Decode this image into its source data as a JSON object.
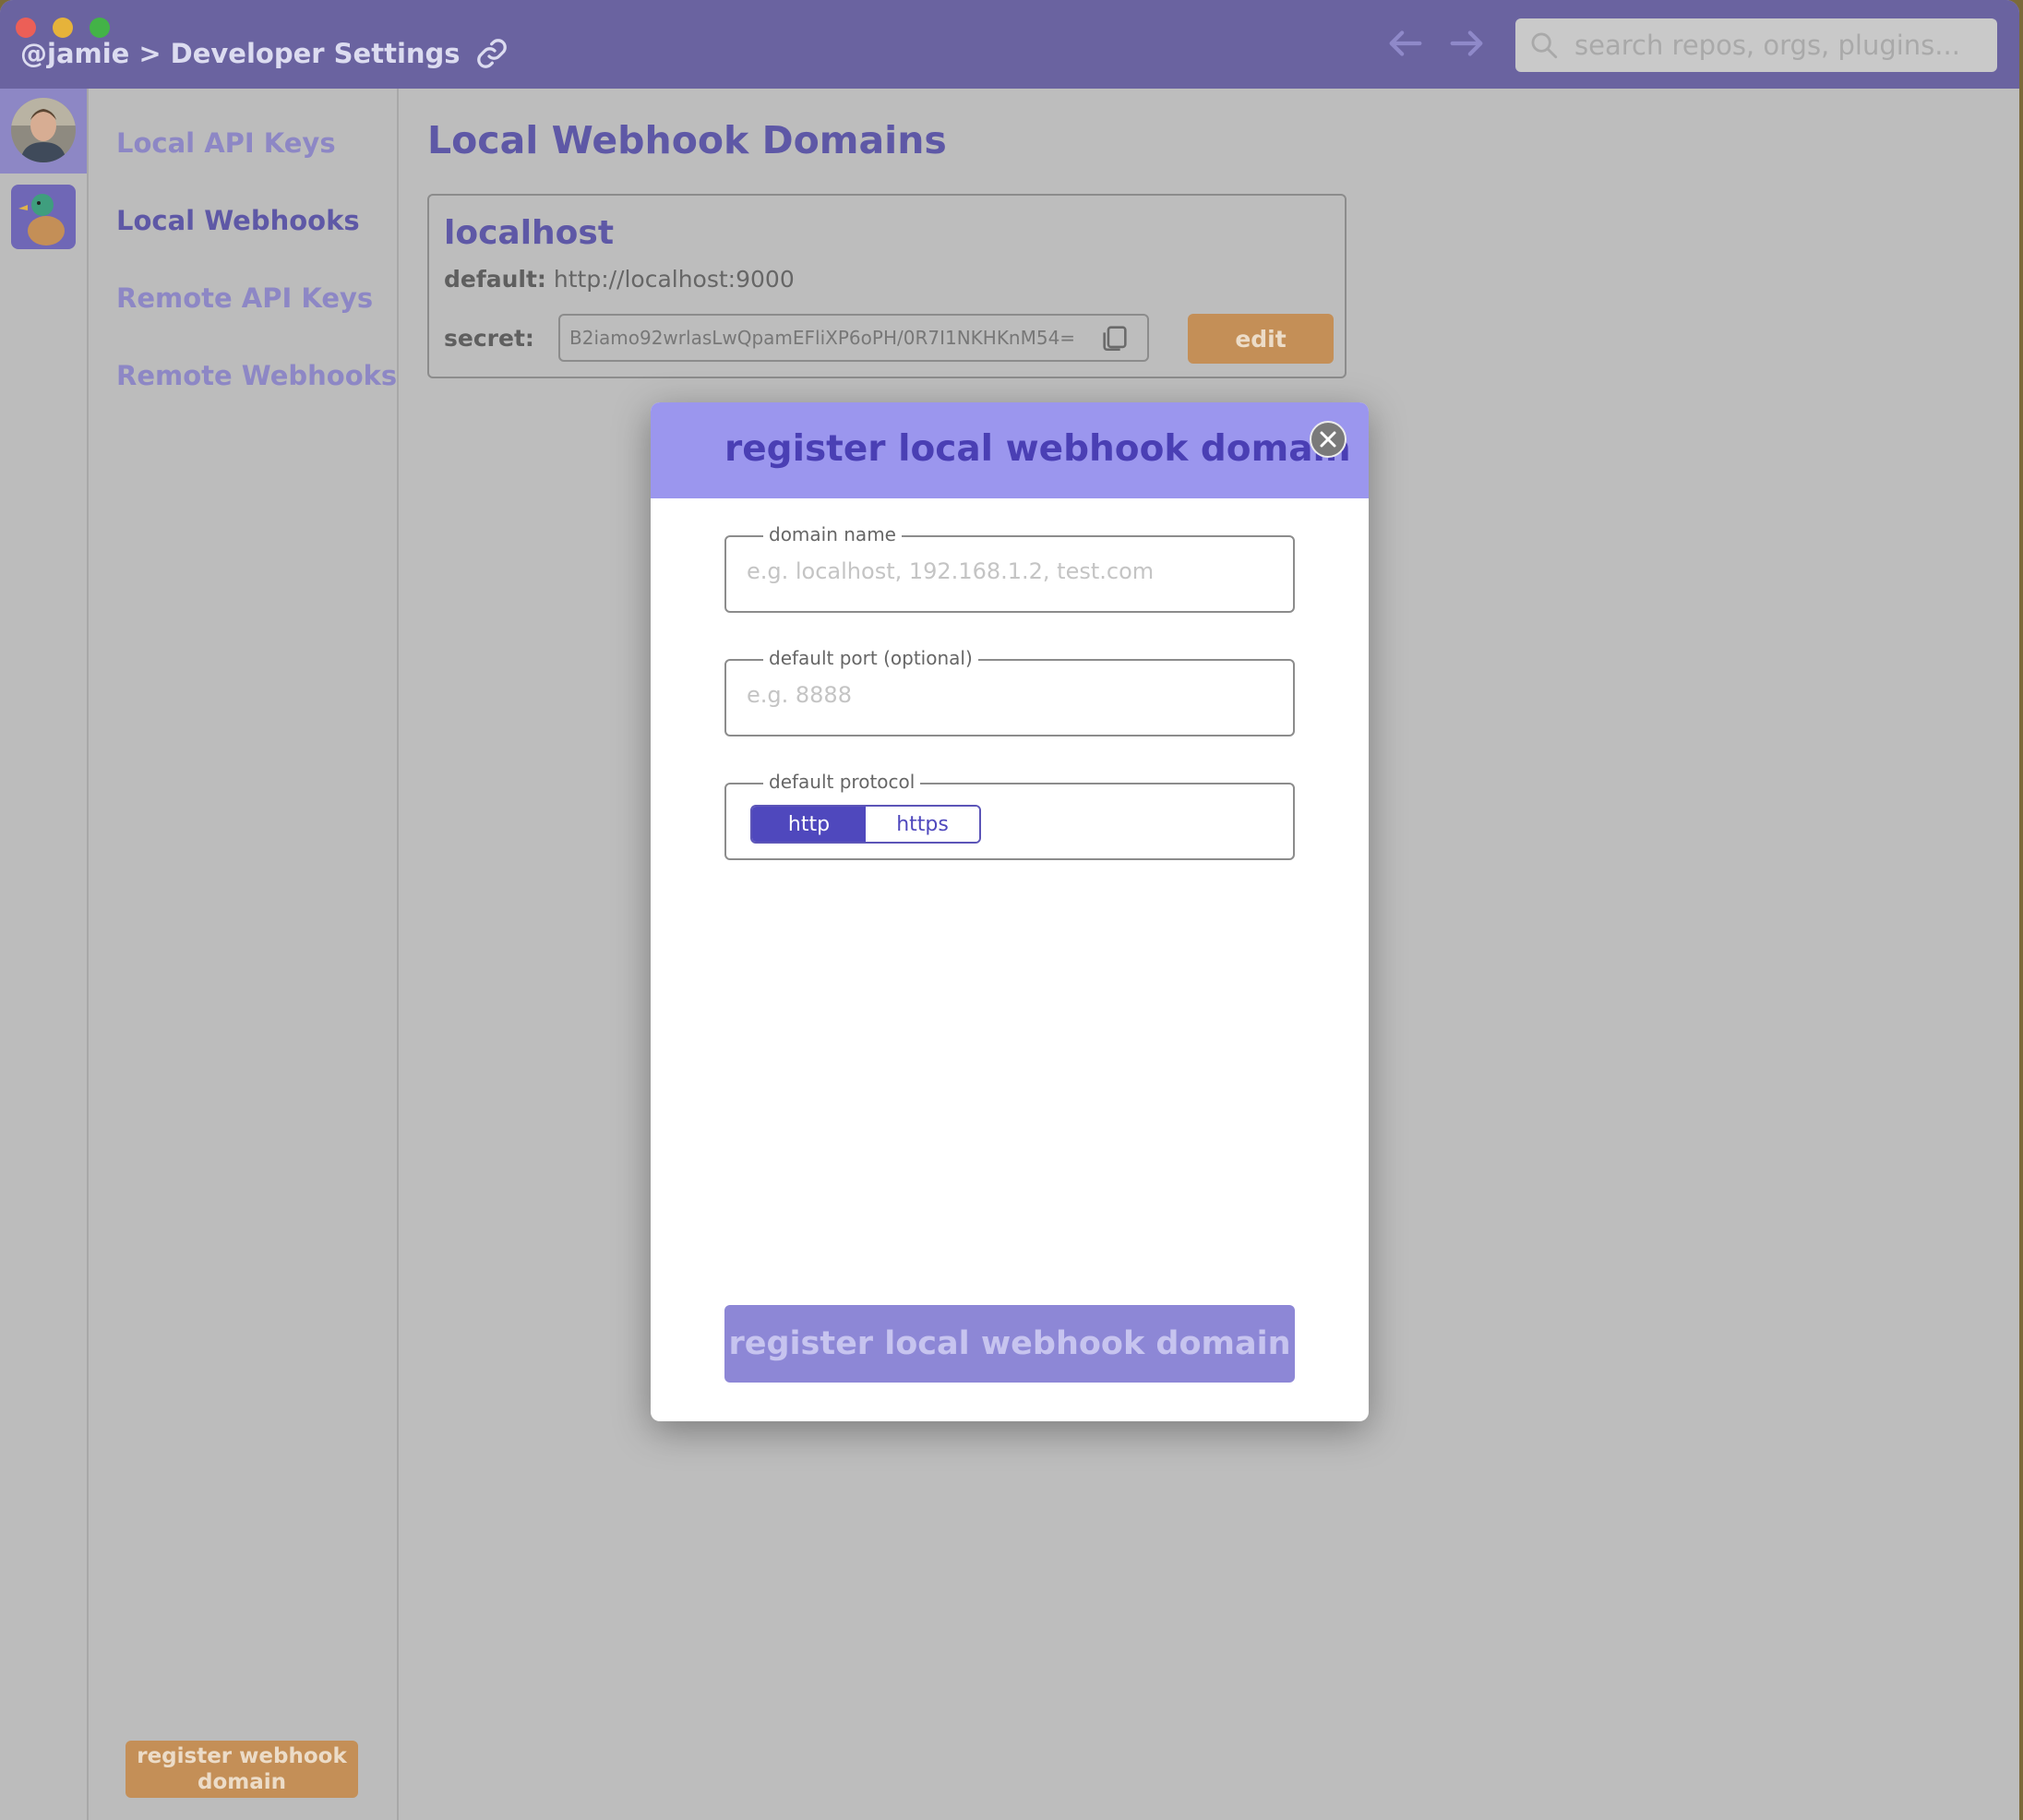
{
  "window": {
    "breadcrumb": {
      "user": "@jamie",
      "separator": ">",
      "page": "Developer Settings"
    },
    "search": {
      "placeholder": "search repos, orgs, plugins..."
    }
  },
  "sidebar": {
    "items": [
      {
        "label": "Local API Keys",
        "active": false
      },
      {
        "label": "Local Webhooks",
        "active": true
      },
      {
        "label": "Remote API Keys",
        "active": false
      },
      {
        "label": "Remote Webhooks",
        "active": false
      }
    ],
    "register_button": "register webhook domain"
  },
  "main": {
    "title": "Local Webhook Domains",
    "domains": [
      {
        "name": "localhost",
        "default_label": "default:",
        "default_value": "http://localhost:9000",
        "secret_label": "secret:",
        "secret_value": "B2iamo92wrlasLwQpamEFliXP6oPH/0R7I1NKHKnM54=",
        "edit_label": "edit"
      }
    ]
  },
  "modal": {
    "title": "register local webhook domain",
    "domain_name": {
      "legend": "domain name",
      "placeholder": "e.g. localhost, 192.168.1.2, test.com",
      "value": ""
    },
    "default_port": {
      "legend": "default port (optional)",
      "placeholder": "e.g. 8888",
      "value": ""
    },
    "default_protocol": {
      "legend": "default protocol",
      "options": [
        "http",
        "https"
      ],
      "selected": "http"
    },
    "submit_label": "register local webhook domain"
  },
  "colors": {
    "titlebar": "#6a63a0",
    "accent": "#5e58a6",
    "modal_header": "#9b96ee",
    "orange_button": "#c48f57"
  },
  "icons": [
    "link-icon",
    "back-arrow-icon",
    "forward-arrow-icon",
    "search-icon",
    "copy-icon",
    "close-icon"
  ]
}
